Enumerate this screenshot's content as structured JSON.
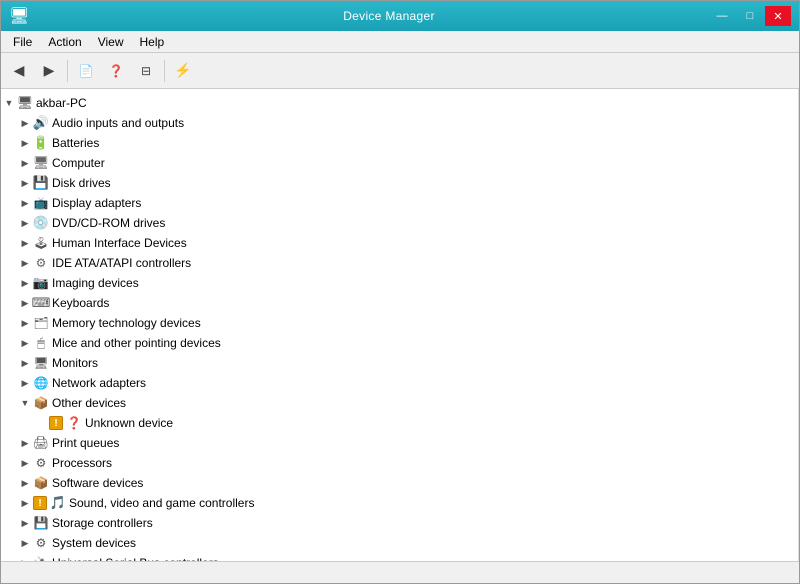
{
  "window": {
    "title": "Device Manager",
    "controls": {
      "minimize": "—",
      "maximize": "□",
      "close": "✕"
    }
  },
  "menubar": {
    "items": [
      "File",
      "Action",
      "View",
      "Help"
    ]
  },
  "toolbar": {
    "buttons": [
      "←",
      "→",
      "⊞",
      "?",
      "⊟",
      "⚡"
    ]
  },
  "tree": {
    "root": {
      "label": "akbar-PC",
      "expanded": true,
      "children": [
        {
          "id": "audio",
          "label": "Audio inputs and outputs",
          "icon": "🔊",
          "iconClass": "icon-audio",
          "expanded": false
        },
        {
          "id": "batteries",
          "label": "Batteries",
          "icon": "🔋",
          "iconClass": "icon-battery",
          "expanded": false
        },
        {
          "id": "computer",
          "label": "Computer",
          "icon": "💻",
          "iconClass": "icon-computer",
          "expanded": false
        },
        {
          "id": "disk",
          "label": "Disk drives",
          "icon": "💾",
          "iconClass": "icon-disk",
          "expanded": false
        },
        {
          "id": "display",
          "label": "Display adapters",
          "icon": "🖥",
          "iconClass": "icon-display",
          "expanded": false
        },
        {
          "id": "dvd",
          "label": "DVD/CD-ROM drives",
          "icon": "💿",
          "iconClass": "icon-dvd",
          "expanded": false
        },
        {
          "id": "hid",
          "label": "Human Interface Devices",
          "icon": "🕹",
          "iconClass": "icon-hid",
          "expanded": false
        },
        {
          "id": "ide",
          "label": "IDE ATA/ATAPI controllers",
          "icon": "⚙",
          "iconClass": "icon-ide",
          "expanded": false
        },
        {
          "id": "imaging",
          "label": "Imaging devices",
          "icon": "📷",
          "iconClass": "icon-imaging",
          "expanded": false
        },
        {
          "id": "keyboards",
          "label": "Keyboards",
          "icon": "⌨",
          "iconClass": "icon-keyboard",
          "expanded": false
        },
        {
          "id": "memory",
          "label": "Memory technology devices",
          "icon": "🗂",
          "iconClass": "icon-memory",
          "expanded": false
        },
        {
          "id": "mice",
          "label": "Mice and other pointing devices",
          "icon": "🖱",
          "iconClass": "icon-mouse",
          "expanded": false
        },
        {
          "id": "monitors",
          "label": "Monitors",
          "icon": "🖥",
          "iconClass": "icon-monitor",
          "expanded": false
        },
        {
          "id": "network",
          "label": "Network adapters",
          "icon": "🌐",
          "iconClass": "icon-network",
          "expanded": false
        },
        {
          "id": "other",
          "label": "Other devices",
          "icon": "❓",
          "iconClass": "icon-other",
          "expanded": true,
          "children": [
            {
              "id": "unknown",
              "label": "Unknown device",
              "icon": "❓",
              "iconClass": "icon-unknown",
              "warning": true
            }
          ]
        },
        {
          "id": "print",
          "label": "Print queues",
          "icon": "🖨",
          "iconClass": "icon-print",
          "expanded": false
        },
        {
          "id": "processors",
          "label": "Processors",
          "icon": "⚙",
          "iconClass": "icon-processor",
          "expanded": false
        },
        {
          "id": "software",
          "label": "Software devices",
          "icon": "📦",
          "iconClass": "icon-software",
          "expanded": false
        },
        {
          "id": "sound",
          "label": "Sound, video and game controllers",
          "icon": "🎵",
          "iconClass": "icon-sound",
          "expanded": false,
          "warning": true
        },
        {
          "id": "storage",
          "label": "Storage controllers",
          "icon": "💾",
          "iconClass": "icon-storage",
          "expanded": false
        },
        {
          "id": "system",
          "label": "System devices",
          "icon": "⚙",
          "iconClass": "icon-system",
          "expanded": false
        },
        {
          "id": "usb",
          "label": "Universal Serial Bus controllers",
          "icon": "🔌",
          "iconClass": "icon-usb",
          "expanded": false
        }
      ]
    }
  },
  "statusbar": {
    "text": ""
  }
}
